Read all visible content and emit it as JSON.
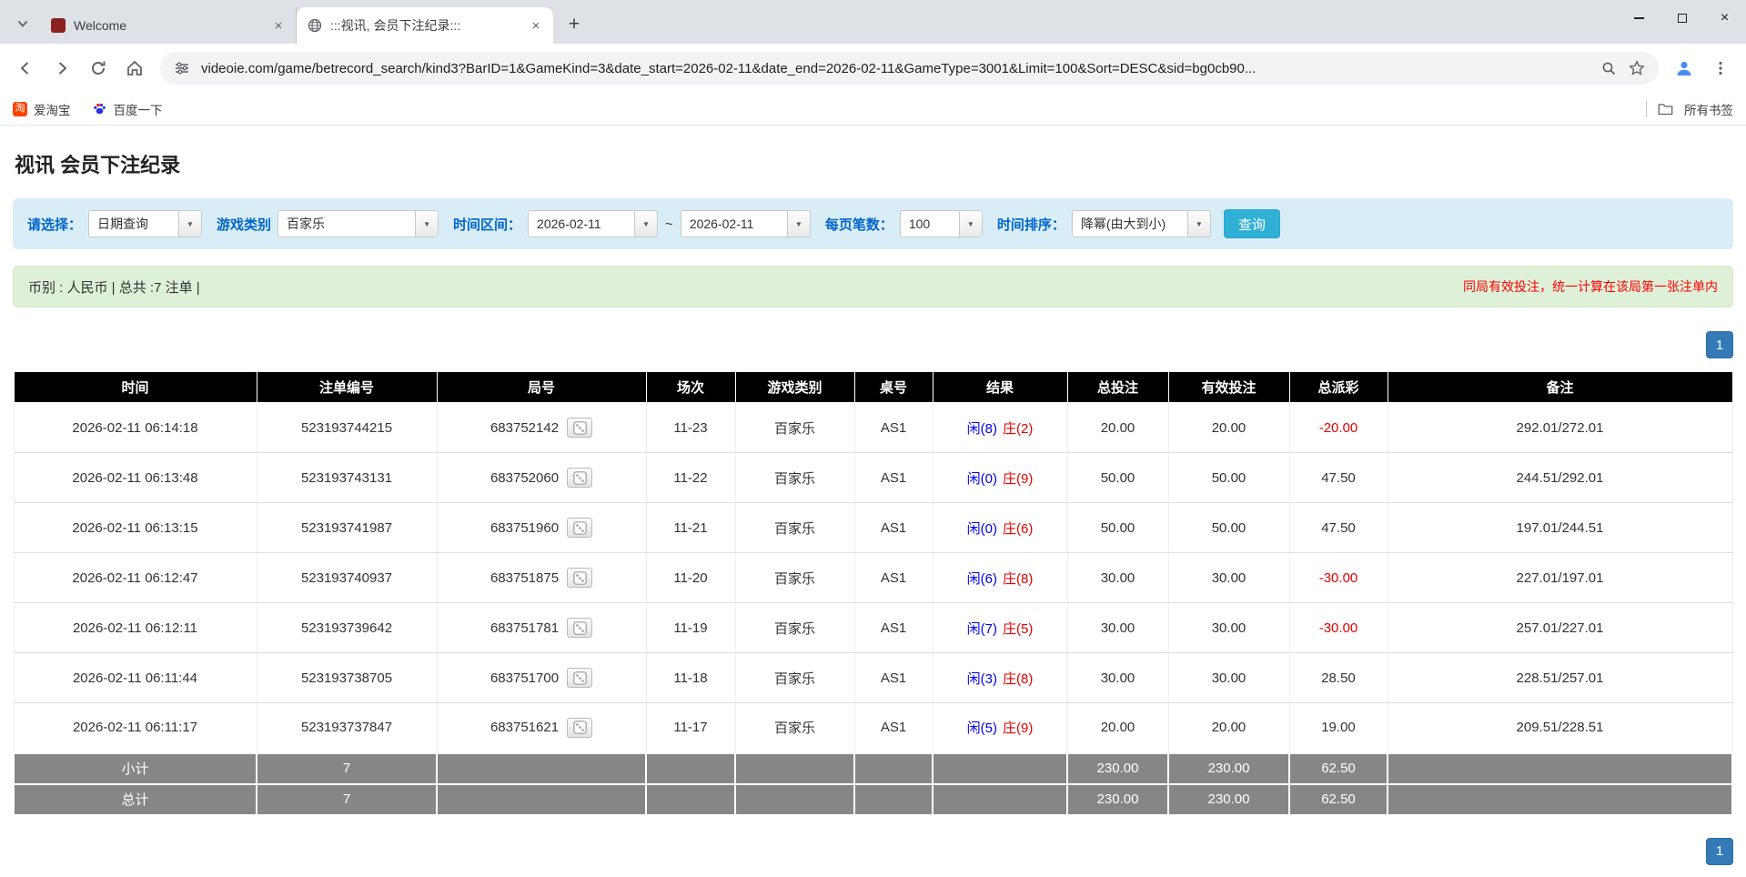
{
  "browser": {
    "tabs": [
      {
        "title": "Welcome"
      },
      {
        "title": ":::视讯, 会员下注纪录:::"
      }
    ],
    "new_tab_label": "+",
    "close_glyph": "×",
    "url": "videoie.com/game/betrecord_search/kind3?BarID=1&GameKind=3&date_start=2026-02-11&date_end=2026-02-11&GameType=3001&Limit=100&Sort=DESC&sid=bg0cb90...",
    "bookmarks": [
      {
        "label": "爱淘宝",
        "favicon_char": "淘"
      },
      {
        "label": "百度一下"
      }
    ],
    "bookmarks_right_label": "所有书签"
  },
  "page": {
    "title": "视讯 会员下注纪录",
    "filters": {
      "select_label": "请选择：",
      "select_value": "日期查询",
      "game_type_label": "游戏类别",
      "game_type_value": "百家乐",
      "date_range_label": "时间区间：",
      "date_start": "2026-02-11",
      "date_separator": "~",
      "date_end": "2026-02-11",
      "per_page_label": "每页笔数：",
      "per_page_value": "100",
      "sort_label": "时间排序：",
      "sort_value": "降幂(由大到小)",
      "search_button": "查询",
      "dropdown_glyph": "▼"
    },
    "info_bar": {
      "left": "币别 : 人民币 | 总共 :7 注单 |",
      "right": "同局有效投注，统一计算在该局第一张注单内"
    },
    "pagination": {
      "page": "1"
    },
    "table": {
      "headers": [
        "时间",
        "注单编号",
        "局号",
        "场次",
        "游戏类别",
        "桌号",
        "结果",
        "总投注",
        "有效投注",
        "总派彩",
        "备注"
      ],
      "rows": [
        {
          "time": "2026-02-11 06:14:18",
          "bet_id": "523193744215",
          "round": "683752142",
          "session": "11-23",
          "game": "百家乐",
          "table_no": "AS1",
          "result_player": "闲(8)",
          "result_banker": "庄(2)",
          "total_bet": "20.00",
          "valid_bet": "20.00",
          "payout": "-20.00",
          "note": "292.01/272.01"
        },
        {
          "time": "2026-02-11 06:13:48",
          "bet_id": "523193743131",
          "round": "683752060",
          "session": "11-22",
          "game": "百家乐",
          "table_no": "AS1",
          "result_player": "闲(0)",
          "result_banker": "庄(9)",
          "total_bet": "50.00",
          "valid_bet": "50.00",
          "payout": "47.50",
          "note": "244.51/292.01"
        },
        {
          "time": "2026-02-11 06:13:15",
          "bet_id": "523193741987",
          "round": "683751960",
          "session": "11-21",
          "game": "百家乐",
          "table_no": "AS1",
          "result_player": "闲(0)",
          "result_banker": "庄(6)",
          "total_bet": "50.00",
          "valid_bet": "50.00",
          "payout": "47.50",
          "note": "197.01/244.51"
        },
        {
          "time": "2026-02-11 06:12:47",
          "bet_id": "523193740937",
          "round": "683751875",
          "session": "11-20",
          "game": "百家乐",
          "table_no": "AS1",
          "result_player": "闲(6)",
          "result_banker": "庄(8)",
          "total_bet": "30.00",
          "valid_bet": "30.00",
          "payout": "-30.00",
          "note": "227.01/197.01"
        },
        {
          "time": "2026-02-11 06:12:11",
          "bet_id": "523193739642",
          "round": "683751781",
          "session": "11-19",
          "game": "百家乐",
          "table_no": "AS1",
          "result_player": "闲(7)",
          "result_banker": "庄(5)",
          "total_bet": "30.00",
          "valid_bet": "30.00",
          "payout": "-30.00",
          "note": "257.01/227.01"
        },
        {
          "time": "2026-02-11 06:11:44",
          "bet_id": "523193738705",
          "round": "683751700",
          "session": "11-18",
          "game": "百家乐",
          "table_no": "AS1",
          "result_player": "闲(3)",
          "result_banker": "庄(8)",
          "total_bet": "30.00",
          "valid_bet": "30.00",
          "payout": "28.50",
          "note": "228.51/257.01"
        },
        {
          "time": "2026-02-11 06:11:17",
          "bet_id": "523193737847",
          "round": "683751621",
          "session": "11-17",
          "game": "百家乐",
          "table_no": "AS1",
          "result_player": "闲(5)",
          "result_banker": "庄(9)",
          "total_bet": "20.00",
          "valid_bet": "20.00",
          "payout": "19.00",
          "note": "209.51/228.51"
        }
      ],
      "subtotal": {
        "label": "小计",
        "count": "7",
        "total_bet": "230.00",
        "valid_bet": "230.00",
        "payout": "62.50"
      },
      "total": {
        "label": "总计",
        "count": "7",
        "total_bet": "230.00",
        "valid_bet": "230.00",
        "payout": "62.50"
      }
    }
  }
}
